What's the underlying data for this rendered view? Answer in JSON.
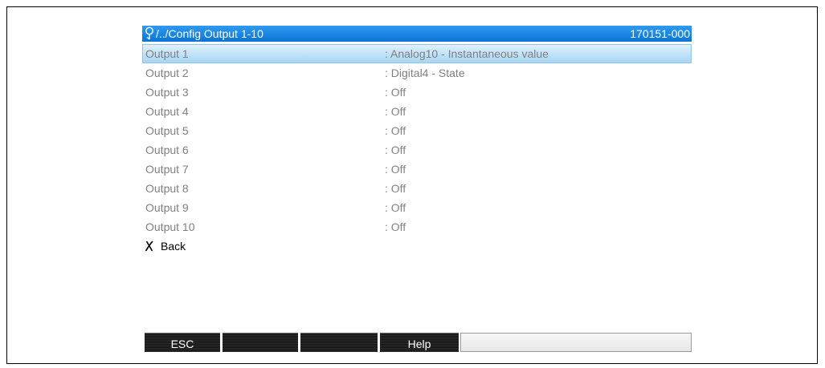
{
  "header": {
    "path": "/../Config Output 1-10",
    "device_code": "170151-000",
    "path_icon": "probe-icon"
  },
  "rows": [
    {
      "label": "Output 1",
      "value": ": Analog10 - Instantaneous value",
      "selected": true
    },
    {
      "label": "Output 2",
      "value": ": Digital4 - State"
    },
    {
      "label": "Output 3",
      "value": ": Off"
    },
    {
      "label": "Output 4",
      "value": ": Off"
    },
    {
      "label": "Output 5",
      "value": ": Off"
    },
    {
      "label": "Output 6",
      "value": ": Off"
    },
    {
      "label": "Output 7",
      "value": ": Off"
    },
    {
      "label": "Output 8",
      "value": ": Off"
    },
    {
      "label": "Output 9",
      "value": ": Off"
    },
    {
      "label": "Output 10",
      "value": ": Off"
    }
  ],
  "back": {
    "label": "Back",
    "icon": "x-back-icon"
  },
  "softkeys": {
    "key1": "ESC",
    "key2": "",
    "key3": "",
    "key4": "Help",
    "key5": ""
  },
  "colors": {
    "titlebar": "#1a86e4",
    "selected_row": "#bfe2f7",
    "row_text": "#808080",
    "softkey": "#161616"
  }
}
